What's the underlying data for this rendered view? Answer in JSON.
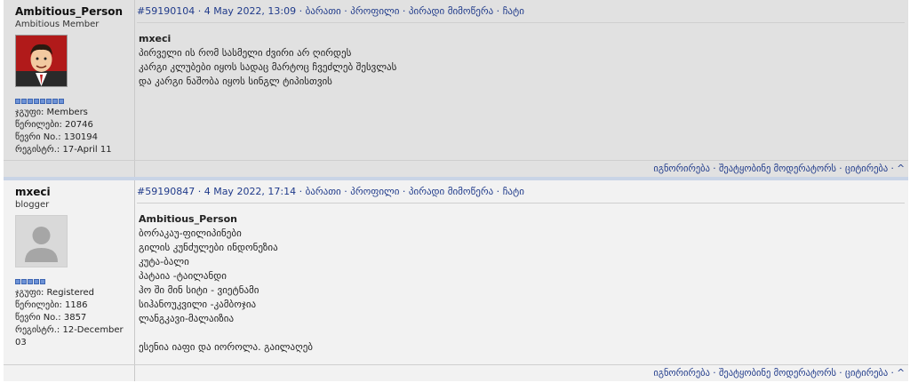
{
  "posts": [
    {
      "author": "Ambitious_Person",
      "rank": "Ambitious Member",
      "avatar_icon": "cartoon-man-avatar",
      "pips": 8,
      "group": "ჯგუფი: Members",
      "posts_count": "წერილები: 20746",
      "member_no": "წევრი No.: 130194",
      "registered": "რეგისტრ.: 17-April 11",
      "post_id": "#59190104",
      "post_date": " · 4 May 2022, 13:09 · ",
      "links": [
        "ბარათი",
        "პროფილი",
        "პირადი მიმოწერა",
        "ჩატი"
      ],
      "quote_author": "mxeci",
      "lines": [
        "პირველი ის რომ სასმელი ძვირი არ ღირდეს",
        "კარგი კლუბები იყოს სადაც მარტოც ჩვეძლებ შესვლას",
        "და კარგი ნაშობა იყოს სინგლ ტიპისთვის"
      ],
      "footer": [
        "იგნორირება",
        "შეატყობინე მოდერატორს",
        "ციტირება",
        "^"
      ]
    },
    {
      "author": "mxeci",
      "rank": "blogger",
      "avatar_icon": "default-avatar",
      "pips": 5,
      "group": "ჯგუფი: Registered",
      "posts_count": "წერილები: 1186",
      "member_no": "წევრი No.: 3857",
      "registered": "რეგისტრ.: 12-December 03",
      "post_id": "#59190847",
      "post_date": " · 4 May 2022, 17:14 · ",
      "links": [
        "ბარათი",
        "პროფილი",
        "პირადი მიმოწერა",
        "ჩატი"
      ],
      "quote_author": "Ambitious_Person",
      "lines": [
        "ბორაკაუ-ფილიპინები",
        "გილის კუნძულები ინდონეზია",
        "კუტა-ბალი",
        "პატაია -ტაილანდი",
        "ჰო ში მინ სიტი - ვიეტნამი",
        "სიჰანოუკვილი -კამბოჯია",
        "ლანგკავი-მალაიზია",
        "",
        "ესენია იაფი და იოროლა. გაილაღებ"
      ],
      "footer": [
        "იგნორირება",
        "შეატყობინე მოდერატორს",
        "ციტირება",
        "^"
      ]
    }
  ]
}
